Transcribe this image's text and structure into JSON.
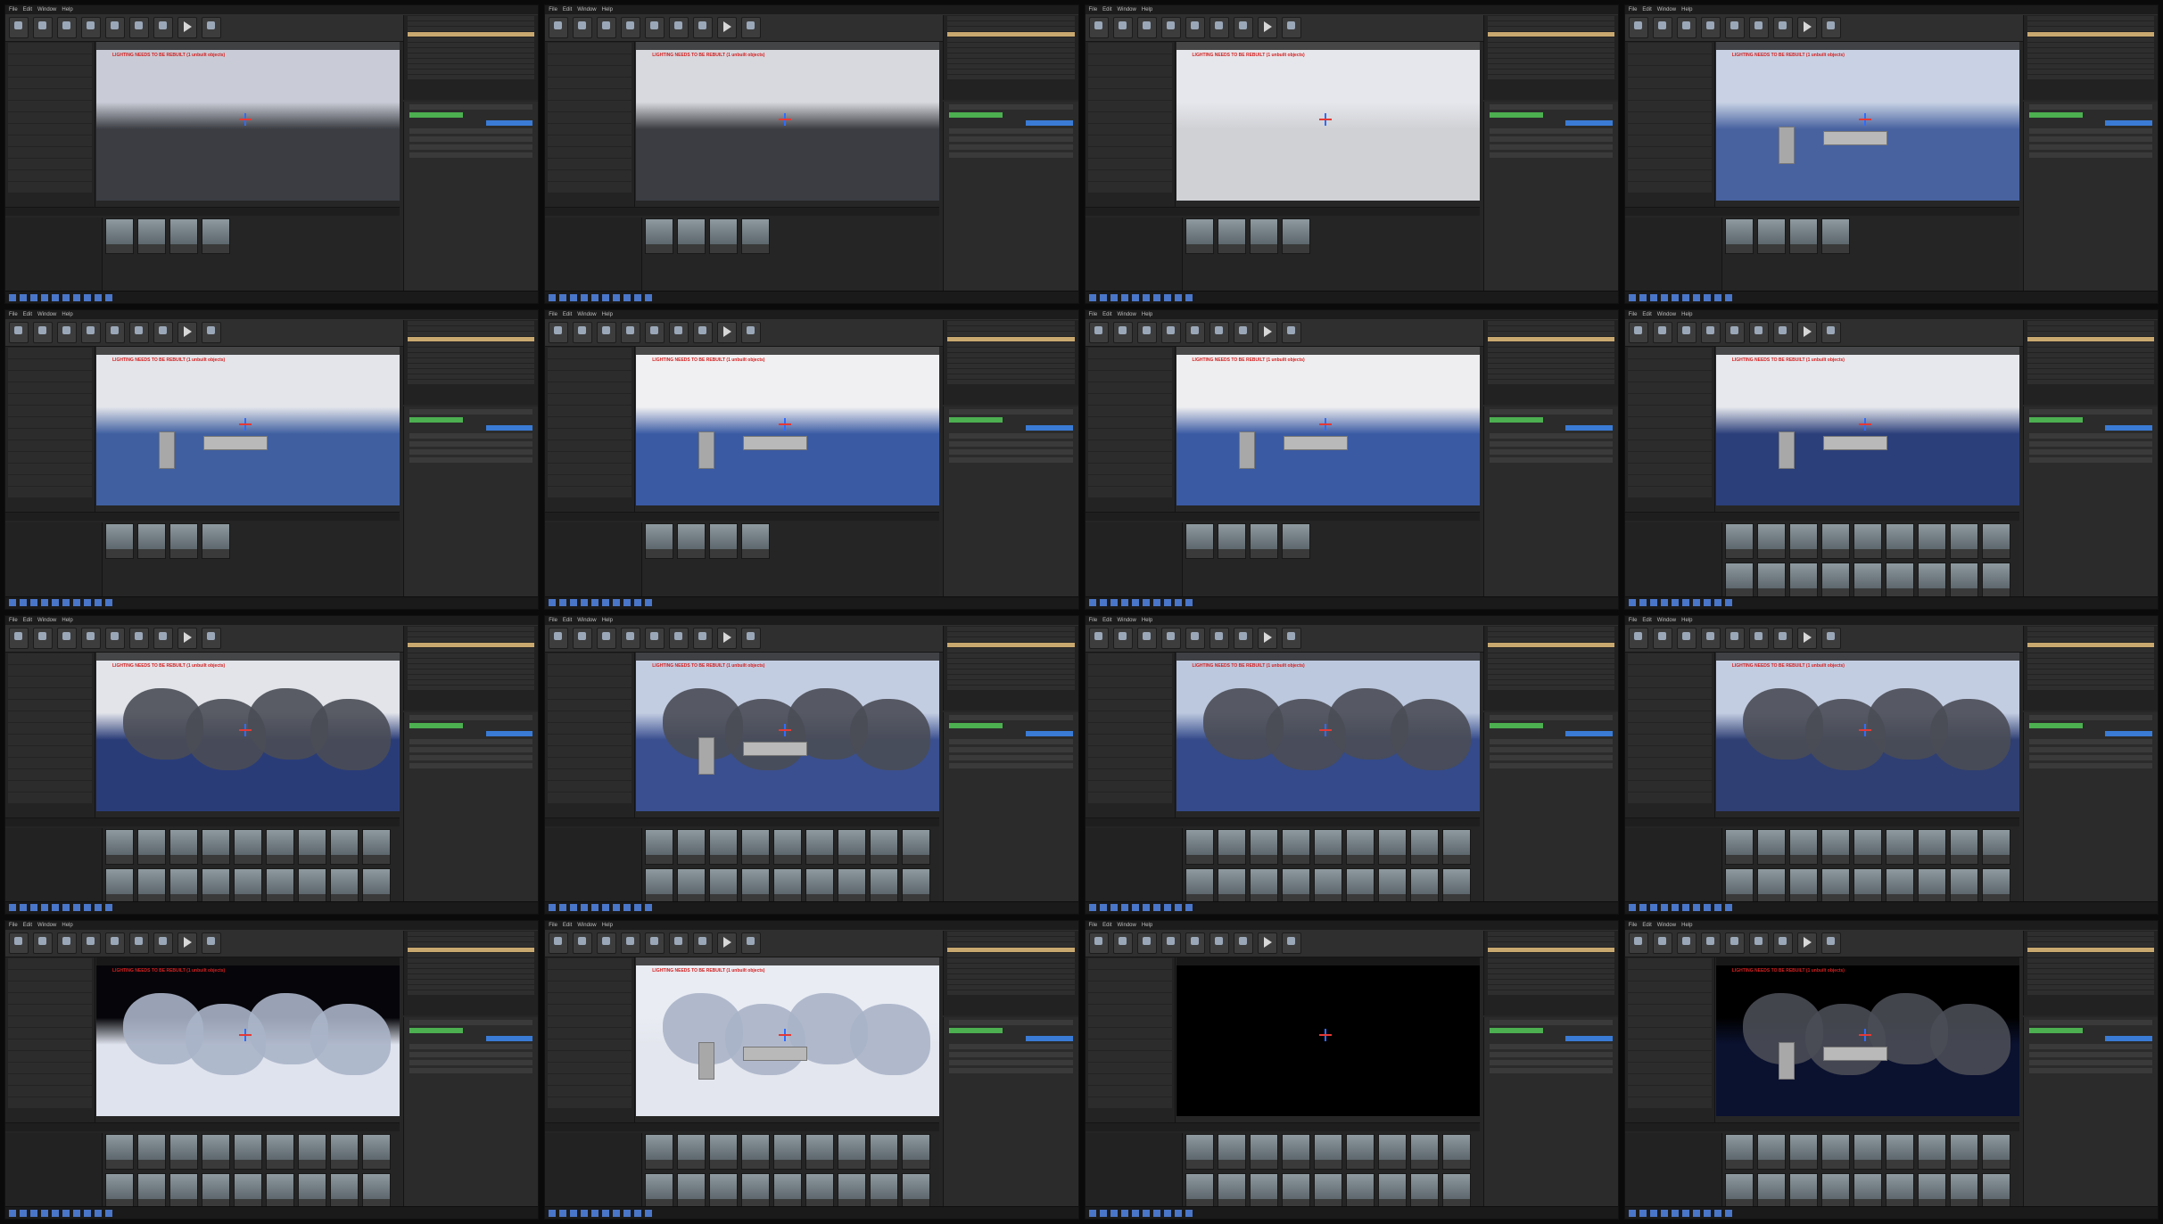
{
  "menu": [
    "File",
    "Edit",
    "Window",
    "Help"
  ],
  "viewport_warning": "LIGHTING NEEDS TO BE REBUILT (1 unbuilt objects)",
  "scenes": [
    {
      "sky": "#c9ccd6",
      "ground": "#3b3d43",
      "kind": "empty-plane"
    },
    {
      "sky": "#d7d9df",
      "ground": "#3b3d43",
      "kind": "plane-far"
    },
    {
      "sky": "#e6e7ec",
      "ground": "#cfd1d5",
      "kind": "white-plane"
    },
    {
      "sky": "#c8d2e4",
      "ground": "#4862a0",
      "kind": "water-platform"
    },
    {
      "sky": "#e3e5ea",
      "ground": "#3f5fa0",
      "kind": "water-table"
    },
    {
      "sky": "#f0f0f2",
      "ground": "#3a5aa3",
      "kind": "arches"
    },
    {
      "sky": "#eeeef0",
      "ground": "#3a5aa3",
      "kind": "ruins"
    },
    {
      "sky": "#e6e8ed",
      "ground": "#2b3f7a",
      "kind": "aerial"
    },
    {
      "sky": "#e2e4ea",
      "ground": "#2a3c78",
      "kind": "rocks"
    },
    {
      "sky": "#c3cde2",
      "ground": "#3a4f8f",
      "kind": "rocks-ruins"
    },
    {
      "sky": "#bcc8de",
      "ground": "#344a8a",
      "kind": "rocks-right"
    },
    {
      "sky": "#c3cde2",
      "ground": "#2f3f73",
      "kind": "rocks-far"
    },
    {
      "sky": "#06060a",
      "ground": "#dfe3ee",
      "kind": "night-rocks"
    },
    {
      "sky": "#e9ecf3",
      "ground": "#e3e6ee",
      "kind": "white-rocks"
    },
    {
      "sky": "#000000",
      "ground": "#000000",
      "kind": "dark"
    },
    {
      "sky": "#000000",
      "ground": "#0b1230",
      "kind": "bw-rocks"
    }
  ]
}
